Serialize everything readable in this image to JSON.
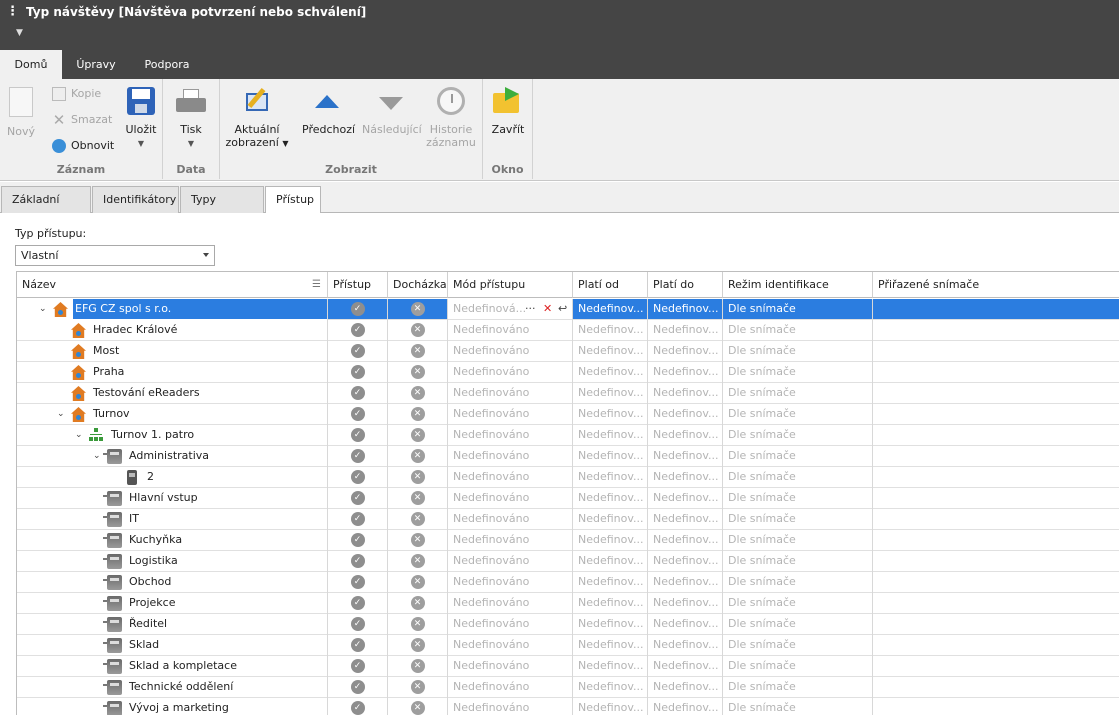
{
  "window": {
    "title": "Typ návštěvy [Návštěva potvrzení nebo schválení]"
  },
  "ribbon_tabs": [
    "Domů",
    "Úpravy",
    "Podpora"
  ],
  "ribbon": {
    "new": "Nový",
    "copy": "Kopie",
    "delete": "Smazat",
    "refresh": "Obnovit",
    "save": "Uložit",
    "print": "Tisk",
    "current_view_1": "Aktuální",
    "current_view_2": "zobrazení",
    "prev": "Předchozí",
    "next": "Následující",
    "history_1": "Historie",
    "history_2": "záznamu",
    "close": "Zavřít",
    "groups": {
      "record": "Záznam",
      "data": "Data",
      "view": "Zobrazit",
      "window": "Okno"
    }
  },
  "subtabs": [
    "Základní údaje",
    "Identifikátory",
    "Typy činností",
    "Přístup"
  ],
  "access_type": {
    "label": "Typ přístupu:",
    "value": "Vlastní"
  },
  "grid": {
    "headers": [
      "Název",
      "Přístup",
      "Docházka",
      "Mód přístupu",
      "Platí od",
      "Platí do",
      "Režim identifikace",
      "Přiřazené snímače"
    ],
    "rows": [
      {
        "name": "EFG CZ spol s r.o.",
        "mode": "Nedefinová...",
        "from": "Nedefinov...",
        "to": "Nedefinov...",
        "ident": "Dle snímače"
      },
      {
        "name": "Hradec Králové",
        "mode": "Nedefinováno",
        "from": "Nedefinov...",
        "to": "Nedefinov...",
        "ident": "Dle snímače"
      },
      {
        "name": "Most",
        "mode": "Nedefinováno",
        "from": "Nedefinov...",
        "to": "Nedefinov...",
        "ident": "Dle snímače"
      },
      {
        "name": "Praha",
        "mode": "Nedefinováno",
        "from": "Nedefinov...",
        "to": "Nedefinov...",
        "ident": "Dle snímače"
      },
      {
        "name": "Testování eReaders",
        "mode": "Nedefinováno",
        "from": "Nedefinov...",
        "to": "Nedefinov...",
        "ident": "Dle snímače"
      },
      {
        "name": "Turnov",
        "mode": "Nedefinováno",
        "from": "Nedefinov...",
        "to": "Nedefinov...",
        "ident": "Dle snímače"
      },
      {
        "name": "Turnov 1. patro",
        "mode": "Nedefinováno",
        "from": "Nedefinov...",
        "to": "Nedefinov...",
        "ident": "Dle snímače"
      },
      {
        "name": "Administrativa",
        "mode": "Nedefinováno",
        "from": "Nedefinov...",
        "to": "Nedefinov...",
        "ident": "Dle snímače"
      },
      {
        "name": "2",
        "mode": "Nedefinováno",
        "from": "Nedefinov...",
        "to": "Nedefinov...",
        "ident": "Dle snímače"
      },
      {
        "name": "Hlavní vstup",
        "mode": "Nedefinováno",
        "from": "Nedefinov...",
        "to": "Nedefinov...",
        "ident": "Dle snímače"
      },
      {
        "name": "IT",
        "mode": "Nedefinováno",
        "from": "Nedefinov...",
        "to": "Nedefinov...",
        "ident": "Dle snímače"
      },
      {
        "name": "Kuchyňka",
        "mode": "Nedefinováno",
        "from": "Nedefinov...",
        "to": "Nedefinov...",
        "ident": "Dle snímače"
      },
      {
        "name": "Logistika",
        "mode": "Nedefinováno",
        "from": "Nedefinov...",
        "to": "Nedefinov...",
        "ident": "Dle snímače"
      },
      {
        "name": "Obchod",
        "mode": "Nedefinováno",
        "from": "Nedefinov...",
        "to": "Nedefinov...",
        "ident": "Dle snímače"
      },
      {
        "name": "Projekce",
        "mode": "Nedefinováno",
        "from": "Nedefinov...",
        "to": "Nedefinov...",
        "ident": "Dle snímače"
      },
      {
        "name": "Ředitel",
        "mode": "Nedefinováno",
        "from": "Nedefinov...",
        "to": "Nedefinov...",
        "ident": "Dle snímače"
      },
      {
        "name": "Sklad",
        "mode": "Nedefinováno",
        "from": "Nedefinov...",
        "to": "Nedefinov...",
        "ident": "Dle snímače"
      },
      {
        "name": "Sklad a kompletace",
        "mode": "Nedefinováno",
        "from": "Nedefinov...",
        "to": "Nedefinov...",
        "ident": "Dle snímače"
      },
      {
        "name": "Technické oddělení",
        "mode": "Nedefinováno",
        "from": "Nedefinov...",
        "to": "Nedefinov...",
        "ident": "Dle snímače"
      },
      {
        "name": "Vývoj a marketing",
        "mode": "Nedefinováno",
        "from": "Nedefinov...",
        "to": "Nedefinov...",
        "ident": "Dle snímače"
      }
    ]
  },
  "colors": {
    "selection": "#2b7de0",
    "titlebar": "#454545",
    "ribbon": "#f0f0f0"
  }
}
